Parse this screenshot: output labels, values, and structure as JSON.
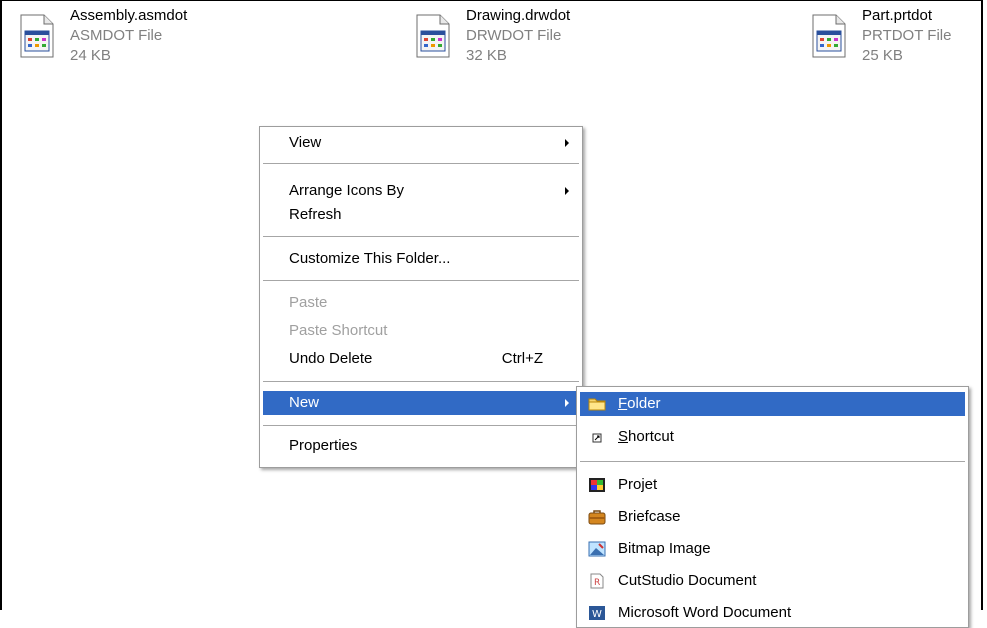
{
  "files": [
    {
      "name": "Assembly.asmdot",
      "type": "ASMDOT File",
      "size": "24 KB",
      "icon": "document-template-icon"
    },
    {
      "name": "Drawing.drwdot",
      "type": "DRWDOT File",
      "size": "32 KB",
      "icon": "document-template-icon"
    },
    {
      "name": "Part.prtdot",
      "type": "PRTDOT File",
      "size": "25 KB",
      "icon": "document-template-icon"
    }
  ],
  "context_menu": {
    "view": "View",
    "arrange": "Arrange Icons By",
    "refresh": "Refresh",
    "customize": "Customize This Folder...",
    "paste": "Paste",
    "paste_shortcut": "Paste Shortcut",
    "undo_delete": "Undo Delete",
    "undo_shortcut": "Ctrl+Z",
    "new": "New",
    "properties": "Properties"
  },
  "new_submenu": {
    "folder_mnemonic": "F",
    "folder_rest": "older",
    "shortcut_mnemonic": "S",
    "shortcut_rest": "hortcut",
    "items": [
      "Projet",
      "Briefcase",
      "Bitmap Image",
      "CutStudio Document",
      "Microsoft Word Document"
    ]
  },
  "colors": {
    "selection": "#316ac5",
    "disabled_text": "#a0a0a0",
    "secondary_text": "#808080"
  }
}
